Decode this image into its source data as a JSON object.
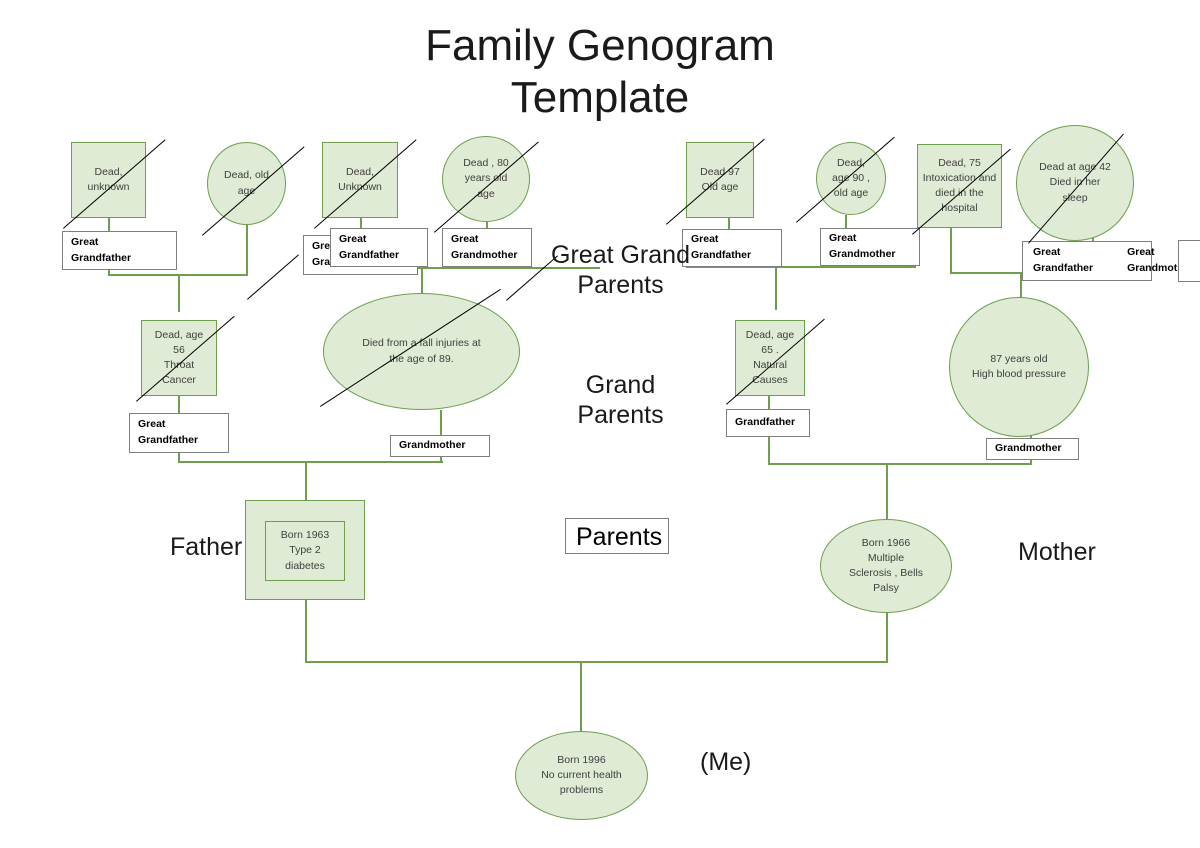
{
  "title": "Family Genogram\nTemplate",
  "section_labels": [
    {
      "name": "great-grand-parents",
      "text": "Great Grand\nParents"
    },
    {
      "name": "grand-parents",
      "text": "Grand\nParents"
    }
  ],
  "side_labels": [
    {
      "name": "father",
      "text": "Father"
    },
    {
      "name": "mother",
      "text": "Mother"
    },
    {
      "name": "me",
      "text": "(Me)"
    }
  ],
  "colors": {
    "node_fill": "#dfebd4",
    "node_border": "#6f9e4e",
    "connector": "#6f9e4e",
    "label_border": "#7f7f7f",
    "text": "#404040",
    "title_text": "#1a1a1a"
  },
  "generations": {
    "great_grand_parents": [
      {
        "name": "ggp-1",
        "shape": "square",
        "deceased": true,
        "text": "Dead,\nunknown",
        "label": "Great\nGrandfather"
      },
      {
        "name": "ggp-2",
        "shape": "circle",
        "deceased": true,
        "text": "Dead, old\nage",
        "label": ""
      },
      {
        "name": "ggp-3",
        "shape": "square",
        "deceased": true,
        "text": "Dead,\nUnknown",
        "label": "Great\nGrandfather"
      },
      {
        "name": "ggp-3b",
        "shape": "none",
        "deceased": false,
        "text": "",
        "label": "Great\nGrandmother"
      },
      {
        "name": "ggp-4",
        "shape": "circle",
        "deceased": true,
        "text": "Dead , 80\nyears old\nage",
        "label": "Great\nGrandmother"
      },
      {
        "name": "ggp-5",
        "shape": "square",
        "deceased": true,
        "text": "Dead 97\nOld age",
        "label": "Great\nGrandfather"
      },
      {
        "name": "ggp-6",
        "shape": "circle",
        "deceased": true,
        "text": "Dead,\nage 90 ,\nold age",
        "label": "Great\nGrandmother"
      },
      {
        "name": "ggp-7",
        "shape": "square",
        "deceased": true,
        "text": "Dead, 75\nIntoxication and\ndied in the\nhospital",
        "label": ""
      },
      {
        "name": "ggp-8",
        "shape": "circle",
        "deceased": true,
        "text": "Dead at age 42\nDied in her\nsleep",
        "label": ""
      }
    ],
    "great_grand_parents_label_pair": {
      "name": "ggp-pair-label",
      "left": "Great\nGrandfather",
      "right": "Great\nGrandmother"
    },
    "empty_box": {
      "name": "empty-label-box",
      "text": ""
    },
    "grand_parents": [
      {
        "name": "gp-1",
        "shape": "square",
        "deceased": true,
        "text": "Dead, age\n56\nThroat\nCancer",
        "label": "Great\nGrandfather"
      },
      {
        "name": "gp-2",
        "shape": "ellipse",
        "deceased": true,
        "text": "Died from a fall injuries  at\nthe age of 89.",
        "label": "Grandmother"
      },
      {
        "name": "gp-3",
        "shape": "square",
        "deceased": true,
        "text": "Dead, age\n65 .\nNatural\nCauses",
        "label": "Grandfather"
      },
      {
        "name": "gp-4",
        "shape": "circle",
        "deceased": false,
        "text": "87  years old\nHigh blood pressure",
        "label": "Grandmother"
      }
    ],
    "parents": [
      {
        "name": "father-node",
        "shape": "square-nested",
        "deceased": false,
        "text": "Born 1963\nType 2 diabetes"
      },
      {
        "name": "mother-node",
        "shape": "circle",
        "deceased": false,
        "text": "Born 1966\nMultiple\nSclerosis , Bells\nPalsy"
      }
    ],
    "parents_label": {
      "name": "parents-label-box",
      "text": "Parents"
    },
    "child": {
      "name": "me-node",
      "shape": "ellipse",
      "deceased": false,
      "text": "Born 1996\nNo current health\nproblems"
    }
  }
}
